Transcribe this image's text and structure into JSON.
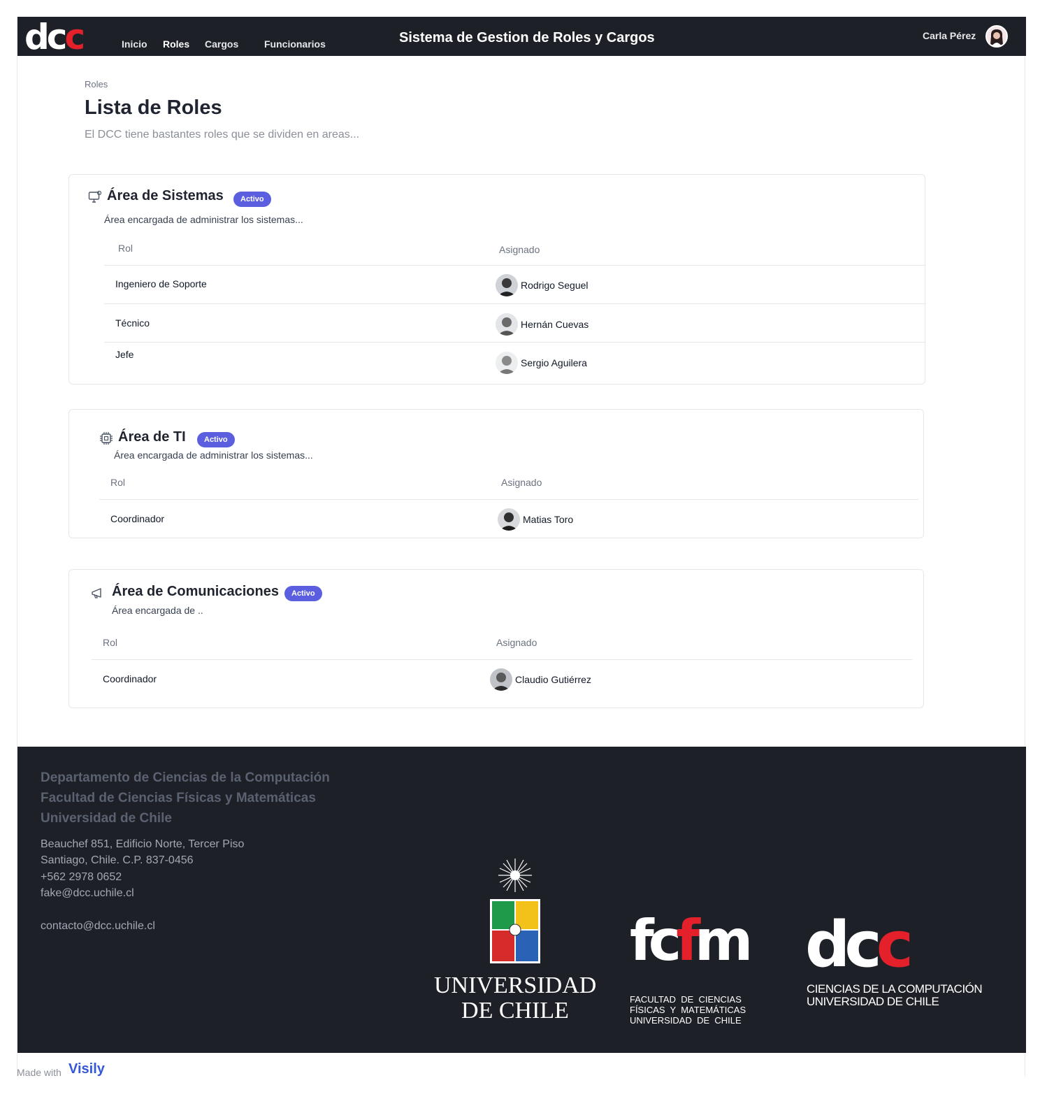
{
  "header": {
    "logo": {
      "part1": "dc",
      "part2": "c"
    },
    "nav": [
      "Inicio",
      "Roles",
      "Cargos",
      "Funcionarios"
    ],
    "active_nav": "Roles",
    "title": "Sistema de Gestion de Roles y Cargos",
    "user_name": "Carla Pérez"
  },
  "page": {
    "breadcrumb": "Roles",
    "title": "Lista de Roles",
    "description": "El DCC tiene bastantes roles que se dividen en areas..."
  },
  "areas": [
    {
      "icon": "monitor-icon",
      "title": "Área de Sistemas",
      "status": "Activo",
      "description": "Área encargada de administrar los sistemas...",
      "columns": [
        "Rol",
        "Asignado"
      ],
      "rows": [
        {
          "role": "Ingeniero de Soporte",
          "assigned": "Rodrigo Seguel"
        },
        {
          "role": "Técnico",
          "assigned": "Hernán Cuevas"
        },
        {
          "role": "Jefe",
          "assigned": "Sergio Aguilera"
        }
      ]
    },
    {
      "icon": "cpu-chip-icon",
      "title": "Área de TI",
      "status": "Activo",
      "description": "Área encargada de administrar los sistemas...",
      "columns": [
        "Rol",
        "Asignado"
      ],
      "rows": [
        {
          "role": "Coordinador",
          "assigned": "Matias Toro"
        }
      ]
    },
    {
      "icon": "megaphone-icon",
      "title": "Área de Comunicaciones",
      "status": "Activo",
      "description": "Área encargada de ..",
      "columns": [
        "Rol",
        "Asignado"
      ],
      "rows": [
        {
          "role": "Coordinador",
          "assigned": "Claudio Gutiérrez"
        }
      ]
    }
  ],
  "footer": {
    "org_lines": [
      "Departamento de Ciencias de la Computación",
      "Facultad de Ciencias Físicas y Matemáticas",
      "Universidad de Chile"
    ],
    "address_lines": [
      "Beauchef 851, Edificio Norte, Tercer Piso",
      "Santiago, Chile. C.P. 837-0456",
      "+562 2978 0652",
      "fake@dcc.uchile.cl"
    ],
    "contact": "contacto@dcc.uchile.cl",
    "logos": {
      "uchile": [
        "UNIVERSIDAD",
        "DE CHILE"
      ],
      "fcfm_mark": {
        "left": "fc",
        "mid": "f",
        "right": "m"
      },
      "fcfm_text": [
        "FACULTAD  DE  CIENCIAS",
        "FÍSICAS  Y  MATEMÁTICAS",
        "UNIVERSIDAD  DE  CHILE"
      ],
      "dcc_mark": {
        "left": "dc",
        "right": "c"
      },
      "dcc_text": [
        "CIENCIAS DE LA COMPUTACIÓN",
        "UNIVERSIDAD DE CHILE"
      ]
    }
  },
  "made_with": {
    "label": "Made with",
    "brand": "Visily"
  },
  "colors": {
    "header_bg": "#1e2028",
    "accent_red": "#e4212b",
    "badge": "#5b5fdf"
  }
}
